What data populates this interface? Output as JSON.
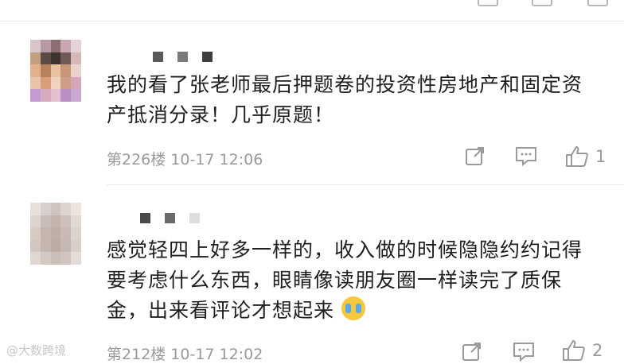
{
  "comments": [
    {
      "text": "我的看了张老师最后押题卷的投资性房地产和固定资产抵消分录！几乎原题！",
      "meta": "第226楼 10-17 12:06",
      "likes": "1",
      "icons": [
        "share-icon",
        "reply-icon",
        "thumbs-up-icon"
      ]
    },
    {
      "text": "感觉轻四上好多一样的，收入做的时候隐隐约约记得要考虑什么东西，眼睛像读朋友圈一样读完了质保金，出来看评论才想起来",
      "emoji": "crying-emoji",
      "meta": "第212楼 10-17 12:02",
      "likes": "2",
      "icons": [
        "share-icon",
        "reply-icon",
        "thumbs-up-icon"
      ]
    }
  ],
  "watermark": "@大数跨境",
  "colors": {
    "text": "#1f1f1f",
    "meta": "#9a9a9a",
    "divider": "#ececec"
  }
}
